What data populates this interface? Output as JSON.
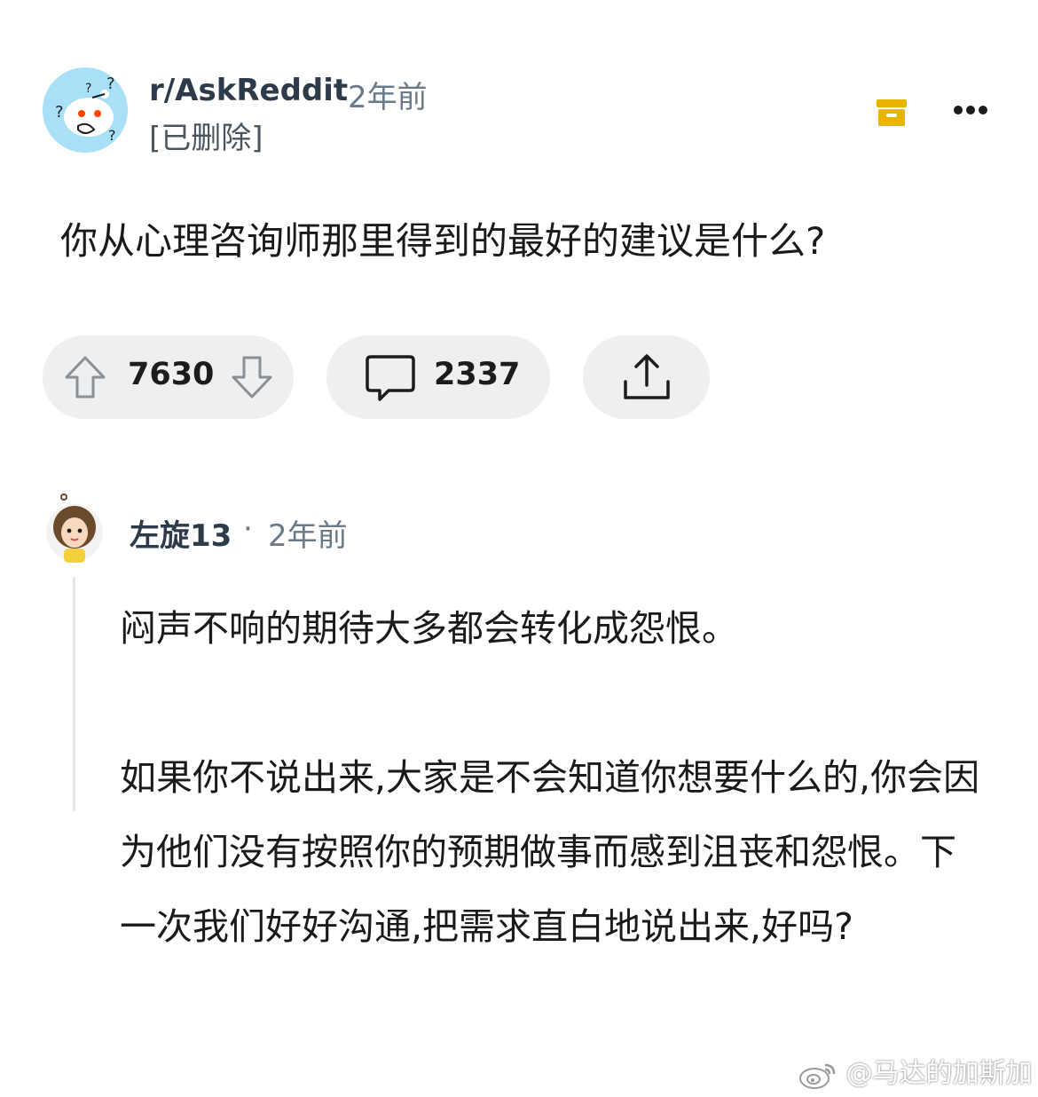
{
  "post": {
    "subreddit": "r/AskReddit",
    "time": "2年前",
    "author": "[已删除]",
    "title": "你从心理咨询师那里得到的最好的建议是什么?",
    "votes": "7630",
    "comments": "2337"
  },
  "icons": {
    "subreddit_avatar": "reddit-snoo-question-icon",
    "save": "archive-box-icon",
    "more": "more-horizontal-icon",
    "upvote": "arrow-up-icon",
    "downvote": "arrow-down-icon",
    "comment": "comment-bubble-icon",
    "share": "share-icon"
  },
  "colors": {
    "save_icon": "#e9b400",
    "pill_bg": "#edeff1",
    "avatar_bg": "#a8e0f8"
  },
  "comment": {
    "user": "左旋13",
    "separator": "·",
    "time": "2年前",
    "paragraphs": [
      "闷声不响的期待大多都会转化成怨恨。",
      "如果你不说出来,大家是不会知道你想要什么的,你会因为他们没有按照你的预期做事而感到沮丧和怨恨。下一次我们好好沟通,把需求直白地说出来,好吗?"
    ]
  },
  "watermark": {
    "text": "@马达的加斯加"
  }
}
